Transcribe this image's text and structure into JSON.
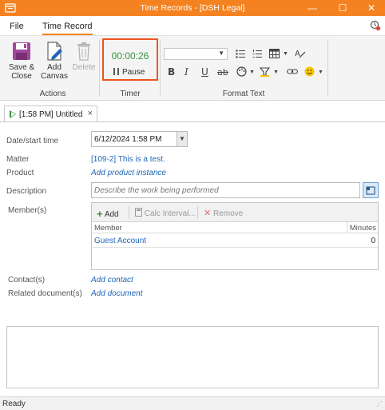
{
  "window": {
    "title": "Time Records - [DSH Legal]",
    "minimize": "—",
    "maximize": "☐",
    "close": "✕",
    "accent": "#f58220"
  },
  "menu": {
    "file": "File",
    "time_record": "Time Record"
  },
  "ribbon": {
    "actions": {
      "save_close_line1": "Save &",
      "save_close_line2": "Close",
      "add_canvas_line1": "Add",
      "add_canvas_line2": "Canvas",
      "delete": "Delete",
      "group_label": "Actions"
    },
    "timer": {
      "value": "00:00:26",
      "pause": "Pause",
      "group_label": "Timer"
    },
    "format_text": {
      "font_select": "",
      "bold": "B",
      "italic": "I",
      "underline": "U",
      "strikethrough": "ab",
      "group_label": "Format Text"
    }
  },
  "record_tab": {
    "label": "[1:58 PM] Untitled",
    "close": "×"
  },
  "form": {
    "date_start_label": "Date/start time",
    "date_start_value": "6/12/2024 1:58 PM",
    "matter_label": "Matter",
    "matter_value": "[109-2] This is a test.",
    "product_label": "Product",
    "product_link": "Add product instance",
    "description_label": "Description",
    "description_placeholder": "Describe the work being performed",
    "members_label": "Member(s)",
    "contacts_label": "Contact(s)",
    "contacts_link": "Add contact",
    "related_docs_label": "Related document(s)",
    "related_docs_link": "Add document"
  },
  "members": {
    "toolbar": {
      "add": "Add",
      "calc_interval": "Calc Interval...",
      "remove": "Remove"
    },
    "columns": [
      "Member",
      "Minutes"
    ],
    "rows": [
      {
        "member": "Guest Account",
        "minutes": "0"
      }
    ]
  },
  "status": {
    "text": "Ready"
  }
}
